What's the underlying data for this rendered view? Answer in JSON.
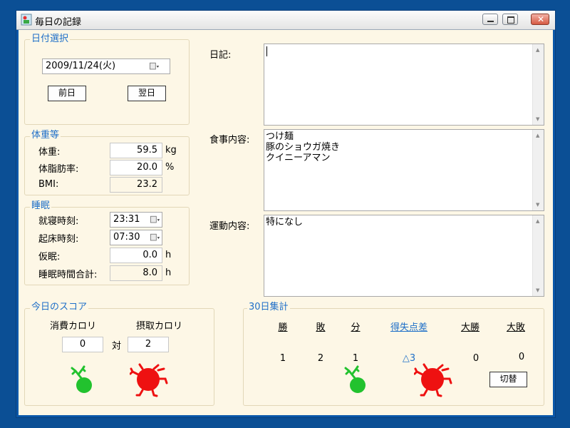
{
  "window": {
    "title": "毎日の記録"
  },
  "date_group": {
    "legend": "日付選択",
    "date": "2009/11/24(火)",
    "prev_button": "前日",
    "next_button": "翌日"
  },
  "weight_group": {
    "legend": "体重等",
    "weight_label": "体重:",
    "weight_value": "59.5",
    "weight_unit": "kg",
    "fat_label": "体脂肪率:",
    "fat_value": "20.0",
    "fat_unit": "%",
    "bmi_label": "BMI:",
    "bmi_value": "23.2"
  },
  "sleep_group": {
    "legend": "睡眠",
    "bedtime_label": "就寝時刻:",
    "bedtime_value": "23:31",
    "waketime_label": "起床時刻:",
    "waketime_value": "07:30",
    "nap_label": "仮眠:",
    "nap_value": "0.0",
    "nap_unit": "h",
    "total_label": "睡眠時間合計:",
    "total_value": "8.0",
    "total_unit": "h"
  },
  "diary": {
    "label": "日記:",
    "text": ""
  },
  "meal": {
    "label": "食事内容:",
    "text": "つけ麺\n豚のショウガ焼き\nクイニーアマン"
  },
  "exercise": {
    "label": "運動内容:",
    "text": "特になし"
  },
  "score_group": {
    "legend": "今日のスコア",
    "consumed_label": "消費カロリ",
    "intake_label": "摂取カロリ",
    "consumed_value": "0",
    "vs_label": "対",
    "intake_value": "2"
  },
  "summary_group": {
    "legend": "30日集計",
    "headers": [
      "勝",
      "敗",
      "分",
      "得失点差",
      "大勝",
      "大敗"
    ],
    "values": [
      "1",
      "2",
      "1",
      "△3",
      "0",
      "0"
    ],
    "switch_button": "切替"
  },
  "colors": {
    "accent": "#1e6fc8",
    "green": "#22c22e",
    "red": "#ee1111",
    "panel": "#fdf7e6"
  },
  "icons": {
    "winner": "green-character-icon",
    "loser": "red-character-icon"
  }
}
